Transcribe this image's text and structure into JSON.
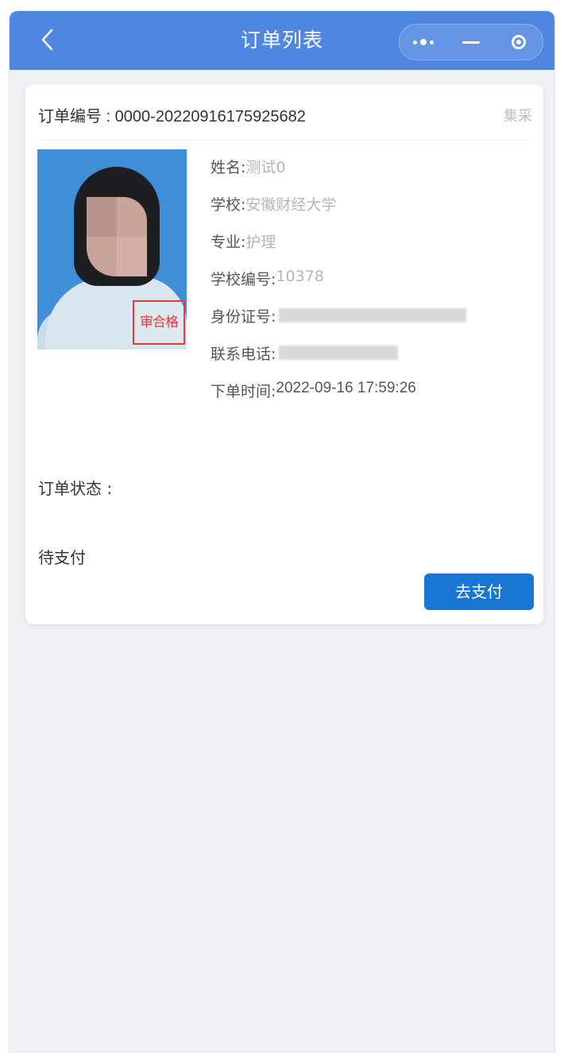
{
  "nav": {
    "title": "订单列表",
    "icons": {
      "back": "chevron-left-icon",
      "more": "more-dots-icon",
      "minimize": "minimize-icon",
      "close": "target-circle-icon"
    }
  },
  "order": {
    "number_label": "订单编号 : 0000-20220916175925682",
    "type": "集采",
    "photo_stamp": "审合格",
    "fields": [
      {
        "label": "姓名:",
        "value": "测试0"
      },
      {
        "label": "学校:",
        "value": "安徽财经大学"
      },
      {
        "label": "专业:",
        "value": "护理"
      },
      {
        "label": "学校编号:",
        "value": "10378"
      },
      {
        "label": "身份证号:",
        "value": ""
      },
      {
        "label": "联系电话:",
        "value": ""
      },
      {
        "label": "下单时间:",
        "value": "2022-09-16 17:59:26"
      }
    ],
    "status_label": "订单状态 :",
    "status_value": "待支付",
    "pay_button": "去支付"
  },
  "colors": {
    "nav_bg": "#4f86e0",
    "pay_button": "#1976d2",
    "page_bg": "#f0f1f4"
  }
}
